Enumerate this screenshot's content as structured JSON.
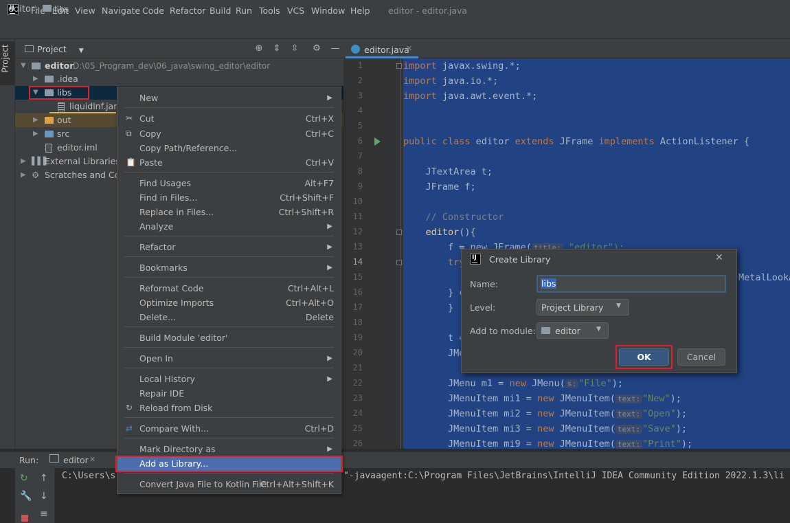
{
  "menubar": {
    "items": [
      "File",
      "Edit",
      "View",
      "Navigate",
      "Code",
      "Refactor",
      "Build",
      "Run",
      "Tools",
      "VCS",
      "Window",
      "Help"
    ],
    "window_title": "editor - editor.java"
  },
  "breadcrumb": {
    "project": "editor",
    "separator": "〉",
    "folder": "libs"
  },
  "project_panel": {
    "title": "Project",
    "side_tab": "Project",
    "tree": {
      "root_name": "editor",
      "root_path": "D:\\05_Program_dev\\06_java\\swing_editor\\editor",
      "idea": ".idea",
      "libs": "libs",
      "jar": "liquidlnf.jar",
      "out": "out",
      "src": "src",
      "iml": "editor.iml",
      "external": "External Libraries",
      "scratches": "Scratches and Cons"
    }
  },
  "context_menu": {
    "new": "New",
    "cut": "Cut",
    "cut_sc": "Ctrl+X",
    "copy": "Copy",
    "copy_sc": "Ctrl+C",
    "copy_path": "Copy Path/Reference...",
    "paste": "Paste",
    "paste_sc": "Ctrl+V",
    "find_usages": "Find Usages",
    "find_usages_sc": "Alt+F7",
    "find_in_files": "Find in Files...",
    "find_in_files_sc": "Ctrl+Shift+F",
    "replace_in_files": "Replace in Files...",
    "replace_in_files_sc": "Ctrl+Shift+R",
    "analyze": "Analyze",
    "refactor": "Refactor",
    "bookmarks": "Bookmarks",
    "reformat": "Reformat Code",
    "reformat_sc": "Ctrl+Alt+L",
    "optimize": "Optimize Imports",
    "optimize_sc": "Ctrl+Alt+O",
    "delete": "Delete...",
    "delete_sc": "Delete",
    "build_module": "Build Module 'editor'",
    "open_in": "Open In",
    "local_history": "Local History",
    "repair_ide": "Repair IDE",
    "reload": "Reload from Disk",
    "compare": "Compare With...",
    "compare_sc": "Ctrl+D",
    "mark_dir": "Mark Directory as",
    "add_library": "Add as Library...",
    "convert": "Convert Java File to Kotlin File",
    "convert_sc": "Ctrl+Alt+Shift+K"
  },
  "editor": {
    "tab": "editor.java",
    "line_numbers": [
      "1",
      "2",
      "3",
      "4",
      "5",
      "6",
      "7",
      "8",
      "9",
      "10",
      "11",
      "12",
      "13",
      "14",
      "15",
      "16",
      "17",
      "18",
      "19",
      "20",
      "21",
      "22",
      "23",
      "24",
      "25",
      "26"
    ]
  },
  "code": {
    "l1_kw": "import",
    "l1": " javax.swing.*;",
    "l2_kw": "import",
    "l2": " java.io.*;",
    "l3_kw": "import",
    "l3": " java.awt.event.*;",
    "l6_kw1": "public class",
    "l6_a": " editor ",
    "l6_kw2": "extends",
    "l6_b": " JFrame ",
    "l6_kw3": "implements",
    "l6_c": " ActionListener {",
    "l8": "    JTextArea t;",
    "l9": "    JFrame f;",
    "l11": "    // Constructor",
    "l12_fn": "    editor",
    "l12": "(){",
    "l13": "        f = new JFrame(",
    "l13_hint": "title:",
    "l13_str": " \"editor\");",
    "l14": "        try",
    "l15_end": "MetalLookA",
    "l16": "        } c",
    "l17": "        }",
    "l19": "        t =",
    "l20": "        JMe",
    "l22_a": "        JMenu m1 = ",
    "l22_kw": "new",
    "l22_b": " JMenu(",
    "l22_hint": "s:",
    "l22_str": "\"File\"",
    "l22_c": ");",
    "l23_a": "        JMenuItem mi1 = ",
    "l23_kw": "new",
    "l23_b": " JMenuItem(",
    "l23_hint": "text:",
    "l23_str": "\"New\"",
    "l23_c": ");",
    "l24_a": "        JMenuItem mi2 = ",
    "l24_kw": "new",
    "l24_b": " JMenuItem(",
    "l24_hint": "text:",
    "l24_str": "\"Open\"",
    "l24_c": ");",
    "l25_a": "        JMenuItem mi3 = ",
    "l25_kw": "new",
    "l25_b": " JMenuItem(",
    "l25_hint": "text:",
    "l25_str": "\"Save\"",
    "l25_c": ");",
    "l26_a": "        JMenuItem mi9 = ",
    "l26_kw": "new",
    "l26_b": " JMenuItem(",
    "l26_hint": "text:",
    "l26_str": "\"Print\"",
    "l26_c": ");"
  },
  "run_panel": {
    "label": "Run:",
    "tab": "editor",
    "console_left": "C:\\Users\\s",
    "console_right": "\"-javaagent:C:\\Program Files\\JetBrains\\IntelliJ IDEA Community Edition 2022.1.3\\li"
  },
  "dialog": {
    "title": "Create Library",
    "name_label": "Name:",
    "name_value": "libs",
    "level_label": "Level:",
    "level_value": "Project Library",
    "module_label": "Add to module:",
    "module_value": "editor",
    "ok": "OK",
    "cancel": "Cancel"
  }
}
